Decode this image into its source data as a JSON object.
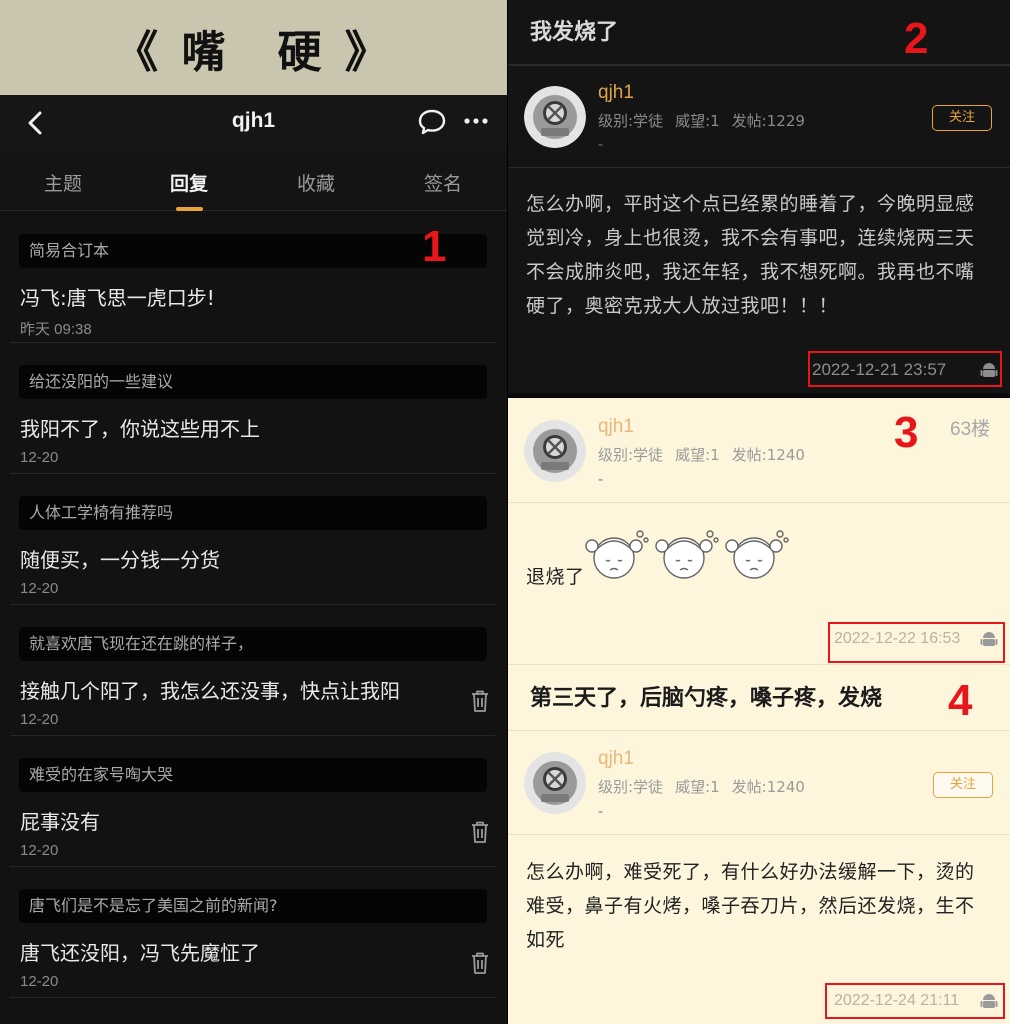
{
  "banner": {
    "title": "《 嘴　硬 》"
  },
  "navbar": {
    "username": "qjh1"
  },
  "tabs": [
    {
      "label": "主题",
      "active": false
    },
    {
      "label": "回复",
      "active": true
    },
    {
      "label": "收藏",
      "active": false
    },
    {
      "label": "签名",
      "active": false
    }
  ],
  "replies": [
    {
      "thread": "简易合订本",
      "text": "冯飞:唐飞思一虎口步!",
      "time": "昨天 09:38",
      "deletable": false
    },
    {
      "thread": "给还没阳的一些建议",
      "text": "我阳不了，你说这些用不上",
      "time": "12-20",
      "deletable": false
    },
    {
      "thread": "人体工学椅有推荐吗",
      "text": "随便买，一分钱一分货",
      "time": "12-20",
      "deletable": false
    },
    {
      "thread": "就喜欢唐飞现在还在跳的样子，",
      "text": "接触几个阳了，我怎么还没事，快点让我阳",
      "time": "12-20",
      "deletable": true
    },
    {
      "thread": "难受的在家号啕大哭",
      "text": "屁事没有",
      "time": "12-20",
      "deletable": true
    },
    {
      "thread": "唐飞们是不是忘了美国之前的新闻?",
      "text": "唐飞还没阳，冯飞先魔怔了",
      "time": "12-20",
      "deletable": true
    }
  ],
  "annotations": {
    "n1": "1",
    "n2": "2",
    "n3": "3",
    "n4": "4"
  },
  "post1": {
    "thread_title": "我发烧了",
    "username": "qjh1",
    "level": "级别:学徒",
    "prestige": "威望:1",
    "posts": "发帖:1229",
    "dash": "-",
    "follow": "关注",
    "lines": [
      "怎么办啊，平时这个点已经累的睡着了，今晚明显感",
      "觉到冷，身上也很烫，我不会有事吧，连续烧两三天",
      "不会成肺炎吧，我还年轻，我不想死啊。我再也不嘴",
      "硬了，奥密克戎大人放过我吧！！！"
    ],
    "timestamp": "2022-12-21 23:57"
  },
  "post2": {
    "username": "qjh1",
    "floor": "63楼",
    "level": "级别:学徒",
    "prestige": "威望:1",
    "posts": "发帖:1240",
    "dash": "-",
    "text": "退烧了",
    "timestamp": "2022-12-22 16:53"
  },
  "post3": {
    "headline": "第三天了，后脑勺疼，嗓子疼，发烧",
    "username": "qjh1",
    "level": "级别:学徒",
    "prestige": "威望:1",
    "posts": "发帖:1240",
    "dash": "-",
    "follow": "关注",
    "lines": [
      "怎么办啊，难受死了，有什么好办法缓解一下，烫的",
      "难受，鼻子有火烤，嗓子吞刀片，然后还发烧，生不",
      "如死"
    ],
    "timestamp": "2022-12-24 21:11"
  },
  "colors": {
    "accent": "#e8a33b",
    "annotation_red": "#e8151b",
    "light_bg": "#fdf5dc",
    "dark_bg": "#141414"
  }
}
